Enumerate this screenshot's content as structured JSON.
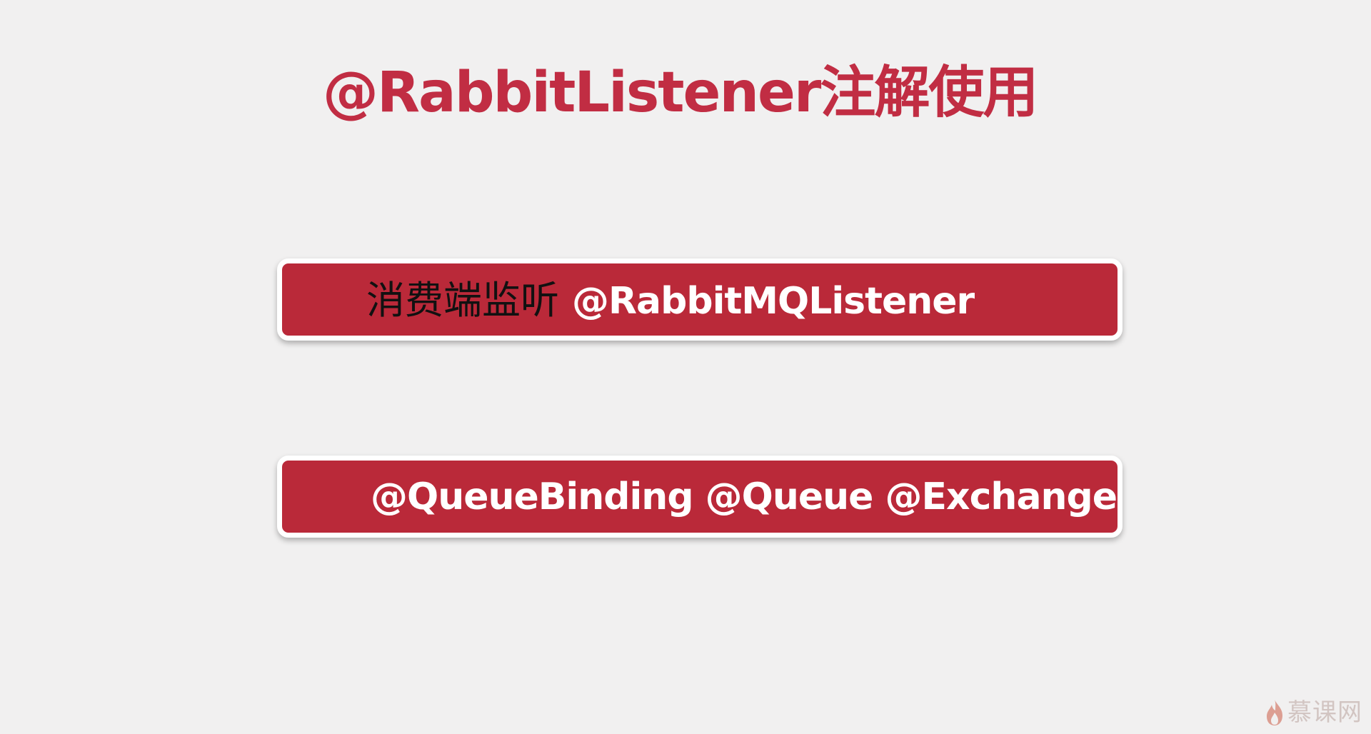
{
  "title": "@RabbitListener注解使用",
  "boxes": [
    {
      "prefix": "消费端监听",
      "text": "@RabbitMQListener"
    },
    {
      "text": "@QueueBinding @Queue @Exchange"
    }
  ],
  "watermark": {
    "text": "慕课网",
    "icon": "flame-icon"
  },
  "colors": {
    "background": "#f1f0f0",
    "accent": "#c12d43",
    "bar": "#ba2939",
    "bar_text": "#ffffff",
    "bar_prefix_text": "#111111"
  }
}
